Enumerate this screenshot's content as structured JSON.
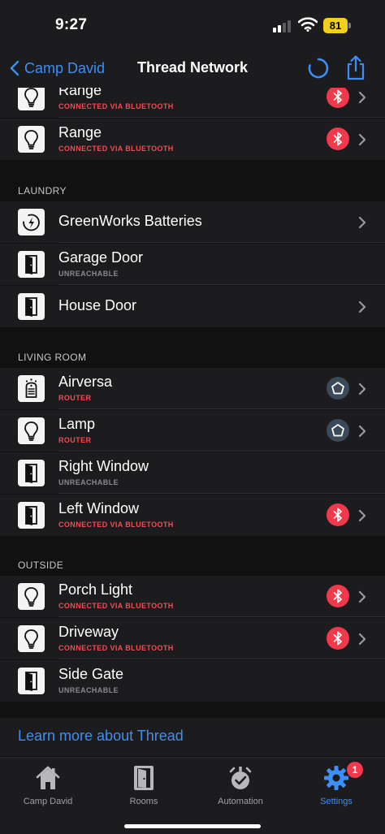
{
  "status_bar": {
    "time": "9:27",
    "battery": "81"
  },
  "nav": {
    "back_label": "Camp David",
    "title": "Thread Network"
  },
  "sections": [
    {
      "header": "",
      "items": [
        {
          "name": "Range",
          "status": "CONNECTED VIA BLUETOOTH",
          "status_color": "red",
          "icon": "bulb-icon",
          "badge": "bluetooth",
          "chevron": true
        },
        {
          "name": "Range",
          "status": "CONNECTED VIA BLUETOOTH",
          "status_color": "red",
          "icon": "bulb-icon",
          "badge": "bluetooth",
          "chevron": true
        }
      ]
    },
    {
      "header": "LAUNDRY",
      "items": [
        {
          "name": "GreenWorks Batteries",
          "status": "",
          "status_color": "",
          "icon": "power-icon",
          "badge": "",
          "chevron": true
        },
        {
          "name": "Garage Door",
          "status": "UNREACHABLE",
          "status_color": "gray",
          "icon": "door-icon",
          "badge": "",
          "chevron": false
        },
        {
          "name": "House Door",
          "status": "",
          "status_color": "",
          "icon": "door-icon",
          "badge": "",
          "chevron": true
        }
      ]
    },
    {
      "header": "LIVING ROOM",
      "items": [
        {
          "name": "Airversa",
          "status": "ROUTER",
          "status_color": "red",
          "icon": "air-purifier-icon",
          "badge": "router",
          "chevron": true
        },
        {
          "name": "Lamp",
          "status": "ROUTER",
          "status_color": "red",
          "icon": "bulb-icon",
          "badge": "router",
          "chevron": true
        },
        {
          "name": "Right Window",
          "status": "UNREACHABLE",
          "status_color": "gray",
          "icon": "door-icon",
          "badge": "",
          "chevron": false
        },
        {
          "name": "Left Window",
          "status": "CONNECTED VIA BLUETOOTH",
          "status_color": "red",
          "icon": "door-icon",
          "badge": "bluetooth",
          "chevron": true
        }
      ]
    },
    {
      "header": "OUTSIDE",
      "items": [
        {
          "name": "Porch Light",
          "status": "CONNECTED VIA BLUETOOTH",
          "status_color": "red",
          "icon": "bulb-icon",
          "badge": "bluetooth",
          "chevron": true
        },
        {
          "name": "Driveway",
          "status": "CONNECTED VIA BLUETOOTH",
          "status_color": "red",
          "icon": "bulb-icon",
          "badge": "bluetooth",
          "chevron": true
        },
        {
          "name": "Side Gate",
          "status": "UNREACHABLE",
          "status_color": "gray",
          "icon": "door-icon",
          "badge": "",
          "chevron": false
        }
      ]
    }
  ],
  "learn_more": "Learn more about Thread",
  "tabs": [
    {
      "label": "Camp David",
      "icon": "home-icon",
      "active": false,
      "badge": ""
    },
    {
      "label": "Rooms",
      "icon": "door-icon",
      "active": false,
      "badge": ""
    },
    {
      "label": "Automation",
      "icon": "automation-icon",
      "active": false,
      "badge": ""
    },
    {
      "label": "Settings",
      "icon": "gear-icon",
      "active": true,
      "badge": "1"
    }
  ],
  "colors": {
    "accent": "#3d8ef7",
    "bluetooth_badge": "#f0394a",
    "router_badge": "#3a4a58",
    "status_red": "#f44a52",
    "status_gray": "#8a8a8e"
  }
}
